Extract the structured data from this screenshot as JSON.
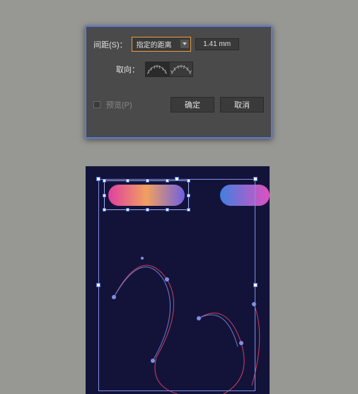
{
  "dialog": {
    "spacing_label": "间距(S)：",
    "spacing_mode": "指定的距离",
    "spacing_value": "1.41 mm",
    "orientation_label": "取向：",
    "preview_label": "预览(P)",
    "ok_label": "确定",
    "cancel_label": "取消"
  }
}
